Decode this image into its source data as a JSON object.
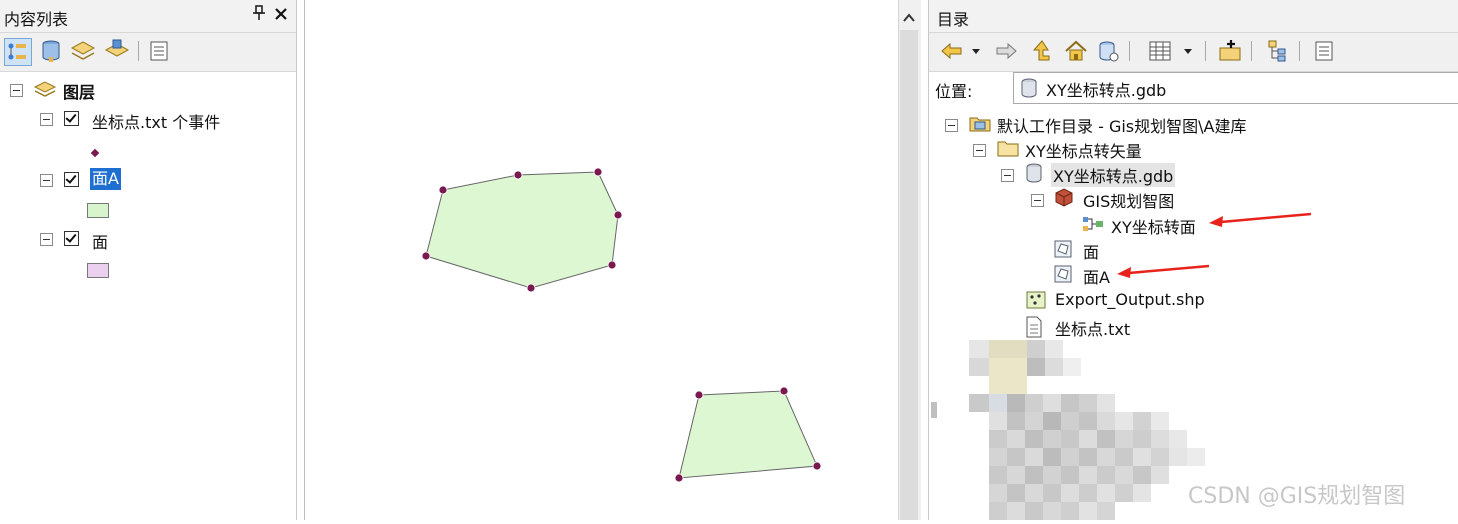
{
  "toc": {
    "title": "内容列表",
    "pin_glyph": "ᵖ",
    "close_glyph": "✕",
    "toolbar_icons": [
      "list-by-drawing-order-icon",
      "list-by-source-icon",
      "list-by-visibility-icon",
      "list-by-selection-icon",
      "options-icon"
    ],
    "layers_root": "图层",
    "layers": [
      {
        "name": "坐标点.txt 个事件",
        "checked": true,
        "symbol": "point",
        "symbol_color": "#7a1850"
      },
      {
        "name": "面A",
        "checked": true,
        "selected": true,
        "symbol": "polygon",
        "symbol_color": "#d8f4cc"
      },
      {
        "name": "面",
        "checked": true,
        "symbol": "polygon",
        "symbol_color": "#ecd0f0"
      }
    ]
  },
  "map": {
    "polygon_fill": "#ddf7d2",
    "vertex_color": "#7a1850"
  },
  "catalog": {
    "title": "目录",
    "toolbar_icons": [
      "back-icon",
      "dropdown-icon",
      "forward-icon",
      "up-one-level-icon",
      "home-icon",
      "connect-folder-icon",
      "views-icon",
      "views-dropdown-icon",
      "add-data-icon",
      "tree-options-icon",
      "options-icon"
    ],
    "location_label": "位置:",
    "location_value": "XY坐标转点.gdb",
    "tree": {
      "root": "默认工作目录 - Gis规划智图\\A建库",
      "folder": "XY坐标点转矢量",
      "gdb": "XY坐标转点.gdb",
      "dataset": "GIS规划智图",
      "toolbox_item": "XY坐标转面",
      "feature_class_1": "面",
      "feature_class_2": "面A",
      "shapefile": "Export_Output.shp",
      "text_file": "坐标点.txt"
    },
    "arrow_color": "#e8231c"
  },
  "watermark": "CSDN @GIS规划智图"
}
